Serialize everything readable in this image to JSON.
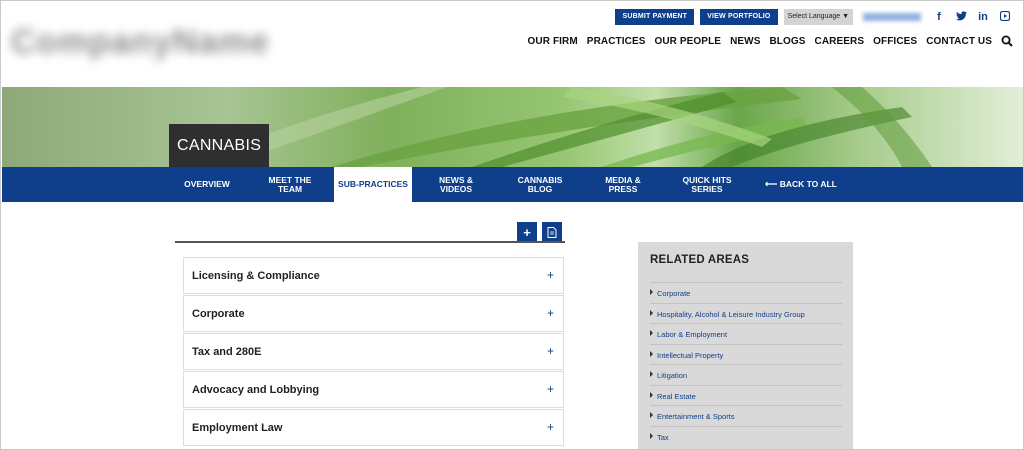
{
  "header": {
    "logo_text": "CompanyName",
    "util_buttons": [
      "SUBMIT PAYMENT",
      "VIEW PORTFOLIO"
    ],
    "language": "Select Language ▼",
    "phone": "(000) 000-0000",
    "social": {
      "facebook": "f",
      "twitter": "t",
      "linkedin": "in",
      "youtube": "▶"
    },
    "nav": [
      "OUR FIRM",
      "PRACTICES",
      "OUR PEOPLE",
      "NEWS",
      "BLOGS",
      "CAREERS",
      "OFFICES",
      "CONTACT US"
    ]
  },
  "hero": {
    "title": "CANNABIS"
  },
  "subnav": {
    "items": [
      {
        "l1": "OVERVIEW",
        "l2": ""
      },
      {
        "l1": "MEET THE",
        "l2": "TEAM"
      },
      {
        "l1": "SUB-PRACTICES",
        "l2": ""
      },
      {
        "l1": "NEWS &",
        "l2": "VIDEOS"
      },
      {
        "l1": "CANNABIS",
        "l2": "BLOG"
      },
      {
        "l1": "MEDIA &",
        "l2": "PRESS"
      },
      {
        "l1": "QUICK HITS",
        "l2": "SERIES"
      },
      {
        "l1": "⟵ BACK TO ALL",
        "l2": ""
      }
    ]
  },
  "tools": {
    "expand": "+",
    "pdf_icon": "pdf-icon"
  },
  "accordion": [
    {
      "label": "Licensing & Compliance",
      "toggle": "+"
    },
    {
      "label": "Corporate",
      "toggle": "+"
    },
    {
      "label": "Tax and 280E",
      "toggle": "+"
    },
    {
      "label": "Advocacy and Lobbying",
      "toggle": "+"
    },
    {
      "label": "Employment Law",
      "toggle": "+"
    }
  ],
  "related": {
    "title": "RELATED AREAS",
    "items": [
      "Corporate",
      "Hospitality, Alcohol & Leisure Industry Group",
      "Labor & Employment",
      "Intellectual Property",
      "Litigation",
      "Real Estate",
      "Entertainment & Sports",
      "Tax"
    ]
  },
  "colors": {
    "brand_blue": "#0f3e8a",
    "hero_dark": "#2f2f2f",
    "sidebar_gray": "#d9d9d9"
  }
}
